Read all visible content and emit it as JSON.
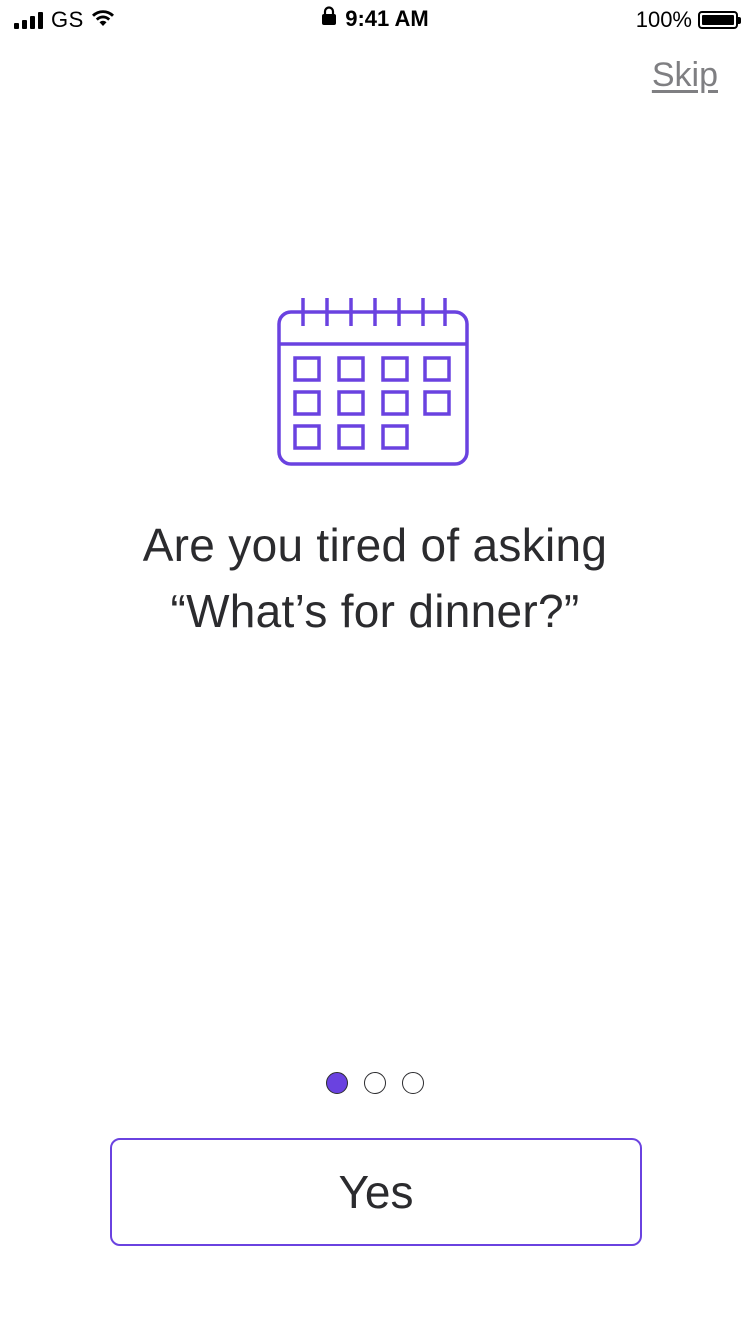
{
  "status_bar": {
    "carrier": "GS",
    "time": "9:41 AM",
    "battery_percent": "100%",
    "battery_level": 1.0,
    "signal_bars": 4
  },
  "header": {
    "skip_label": "Skip"
  },
  "illustration": {
    "icon": "calendar-icon",
    "accent_color": "#6a42e0"
  },
  "main": {
    "headline_line1": "Are you tired of asking",
    "headline_line2": "“What’s for dinner?”"
  },
  "pager": {
    "total_pages": 3,
    "current_page": 1,
    "active_color": "#6a42e0"
  },
  "footer": {
    "yes_label": "Yes"
  }
}
